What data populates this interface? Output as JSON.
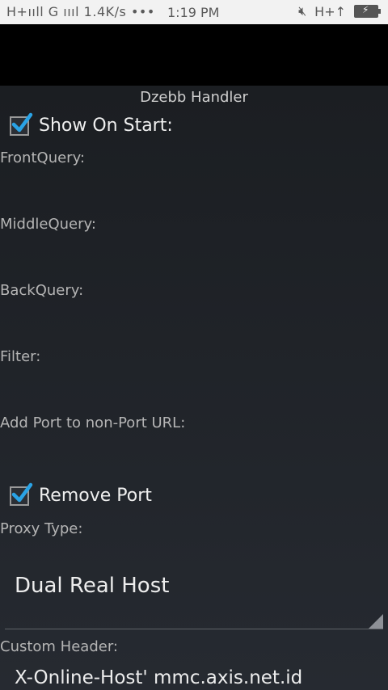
{
  "statusbar": {
    "signal_text": "H+ııll G ıııl",
    "speed": "1.4K/s",
    "dots": "•••",
    "time": "1:19 PM",
    "network": "H+↑",
    "icons": [
      "signal-bars-icon",
      "mute-icon",
      "battery-charging-icon"
    ]
  },
  "app": {
    "title": "Dzebb Handler",
    "show_on_start": {
      "label": "Show On Start:",
      "checked": true
    },
    "front_query_label": "FrontQuery:",
    "middle_query_label": "MiddleQuery:",
    "back_query_label": "BackQuery:",
    "filter_label": "Filter:",
    "add_port_label": "Add Port to non-Port URL:",
    "remove_port": {
      "label": "Remove Port",
      "checked": true
    },
    "proxy_type_label": "Proxy Type:",
    "proxy_type_value": "Dual Real Host",
    "custom_header_label": "Custom Header:",
    "custom_header_value": "X-Online-Host' mmc.axis.net.id"
  },
  "colors": {
    "accent_check": "#2aa3e6",
    "background": "#1b1e22",
    "statusbar": "#f2f2f2"
  }
}
